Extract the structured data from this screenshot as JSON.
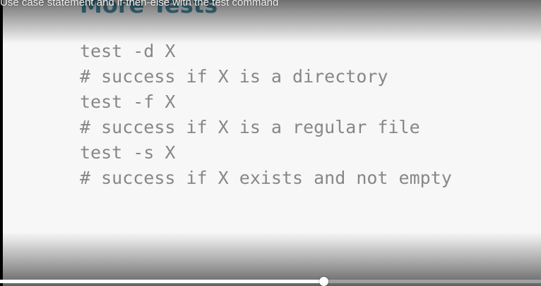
{
  "video": {
    "title": "Use case statement and if-then-else with the test command",
    "progress_fraction": 0.598
  },
  "slide": {
    "title": "More Tests",
    "lines": [
      "test -d X",
      "# success if X is a directory",
      "test -f X",
      "# success if X is a regular file",
      "test -s X",
      "# success if X exists and not empty"
    ]
  },
  "colors": {
    "slide_background": "#f7f7f7",
    "title_color": "#4a90a8",
    "code_color": "#878787",
    "progress_played": "#ffffff"
  }
}
